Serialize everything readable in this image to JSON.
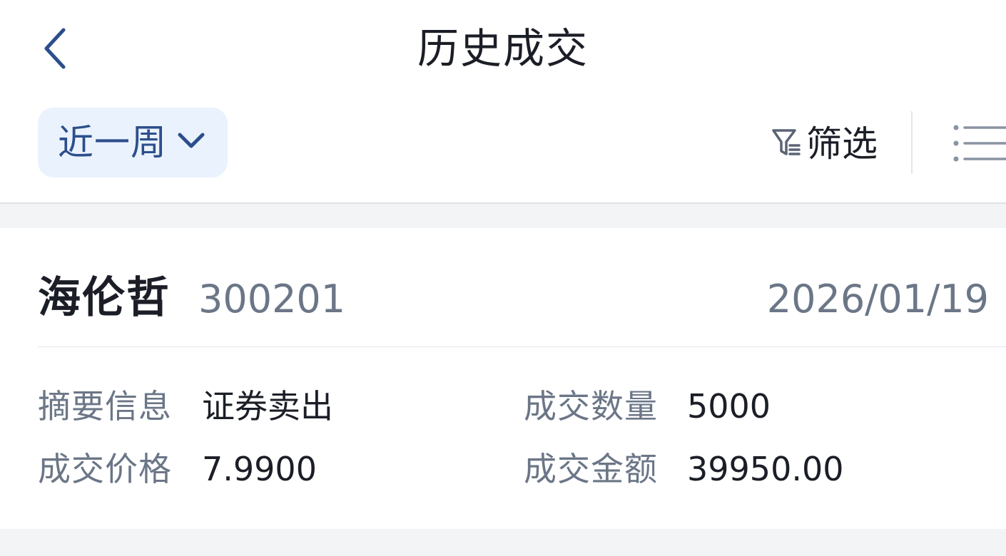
{
  "header": {
    "back_icon": "chevron-left-icon",
    "title": "历史成交"
  },
  "toolbar": {
    "period_selected": "近一周",
    "period_icon": "chevron-down-icon",
    "filter_icon": "filter-icon",
    "filter_label": "筛选",
    "list_view_icon": "list-icon"
  },
  "trades": [
    {
      "name": "海伦哲",
      "code": "300201",
      "date": "2026/01/19",
      "fields": {
        "summary": {
          "label": "摘要信息",
          "value": "证券卖出"
        },
        "quantity": {
          "label": "成交数量",
          "value": "5000"
        },
        "price": {
          "label": "成交价格",
          "value": "7.9900"
        },
        "amount": {
          "label": "成交金额",
          "value": "39950.00"
        }
      }
    }
  ],
  "colors": {
    "accent": "#2c4f8c",
    "accent_bg": "#eaf2fd",
    "text_primary": "#1b1e26",
    "text_secondary": "#6b7687",
    "band_bg": "#f3f4f6"
  }
}
